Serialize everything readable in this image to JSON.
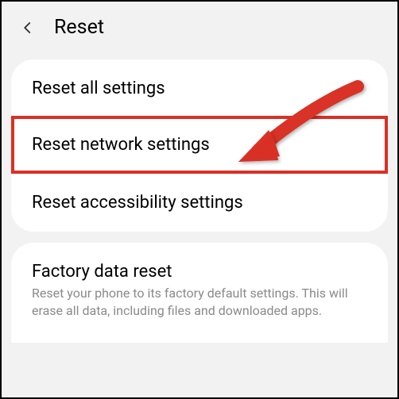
{
  "header": {
    "title": "Reset"
  },
  "items": {
    "reset_all": "Reset all settings",
    "reset_network": "Reset network settings",
    "reset_accessibility": "Reset accessibility settings",
    "factory_title": "Factory data reset",
    "factory_subtitle": "Reset your phone to its factory default settings. This will erase all data, including files and downloaded apps."
  }
}
